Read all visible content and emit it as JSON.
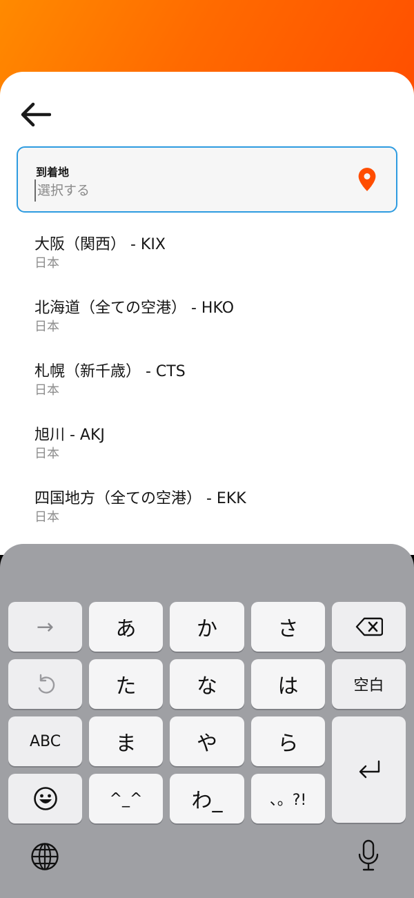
{
  "field": {
    "label": "到着地",
    "placeholder": "選択する",
    "value": ""
  },
  "results": [
    {
      "title": "大阪（関西） - KIX",
      "subtitle": "日本"
    },
    {
      "title": "北海道（全ての空港） - HKO",
      "subtitle": "日本"
    },
    {
      "title": "札幌（新千歳） - CTS",
      "subtitle": "日本"
    },
    {
      "title": "旭川 - AKJ",
      "subtitle": "日本"
    },
    {
      "title": "四国地方（全ての空港） - EKK",
      "subtitle": "日本"
    }
  ],
  "keyboard": {
    "row1": [
      "→",
      "あ",
      "か",
      "さ"
    ],
    "row2": [
      "た",
      "な",
      "は"
    ],
    "space_label": "空白",
    "row3": [
      "ABC",
      "ま",
      "や",
      "ら"
    ],
    "row4": [
      "^_^",
      "わ_",
      "、。?!"
    ]
  },
  "colors": {
    "accent_orange": "#ff5a00",
    "field_border": "#2d9be0",
    "pin": "#ff4d00"
  },
  "icons": [
    "back-arrow-icon",
    "location-pin-icon",
    "backspace-icon",
    "undo-icon",
    "return-icon",
    "emoji-icon",
    "globe-icon",
    "microphone-icon"
  ]
}
